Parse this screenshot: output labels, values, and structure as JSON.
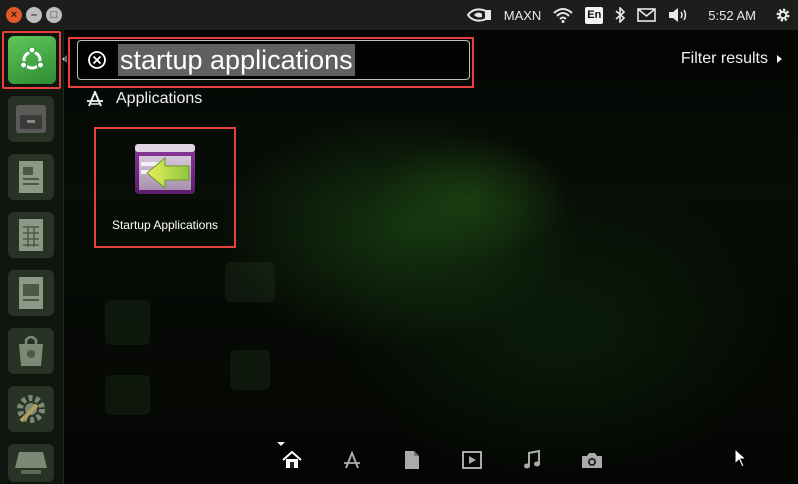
{
  "top_panel": {
    "window_controls": [
      "×",
      "–",
      "□"
    ],
    "indicators": {
      "nvidia_logo": "nvidia-icon",
      "power_mode": "MAXN",
      "network": "wifi-icon",
      "keyboard_layout": "En",
      "bluetooth": "bluetooth-icon",
      "mail": "mail-icon",
      "volume": "volume-icon",
      "clock": "5:52 AM",
      "system_menu": "gear-icon"
    }
  },
  "launcher": {
    "items": [
      {
        "name": "dash-home",
        "icon": "ubuntu-logo-icon"
      },
      {
        "name": "files",
        "icon": "file-cabinet-icon"
      },
      {
        "name": "writer",
        "icon": "document-icon"
      },
      {
        "name": "calc",
        "icon": "spreadsheet-icon"
      },
      {
        "name": "impress",
        "icon": "presentation-icon"
      },
      {
        "name": "software-center",
        "icon": "shopping-bag-icon"
      },
      {
        "name": "system-settings",
        "icon": "gears-icon"
      },
      {
        "name": "workspace-switcher",
        "icon": "workspace-icon"
      }
    ]
  },
  "dash": {
    "search": {
      "value": "startup applications"
    },
    "filter_label": "Filter results",
    "category_label": "Applications",
    "results": [
      {
        "label": "Startup Applications",
        "icon": "startup-applications-icon"
      }
    ],
    "lenses": [
      "home-lens-icon",
      "applications-lens-icon",
      "files-lens-icon",
      "video-lens-icon",
      "music-lens-icon",
      "photo-lens-icon"
    ]
  },
  "colors": {
    "highlight": "#e8413c",
    "panel": "#1d1d1b",
    "ubuntu_green": "#3da33f"
  }
}
